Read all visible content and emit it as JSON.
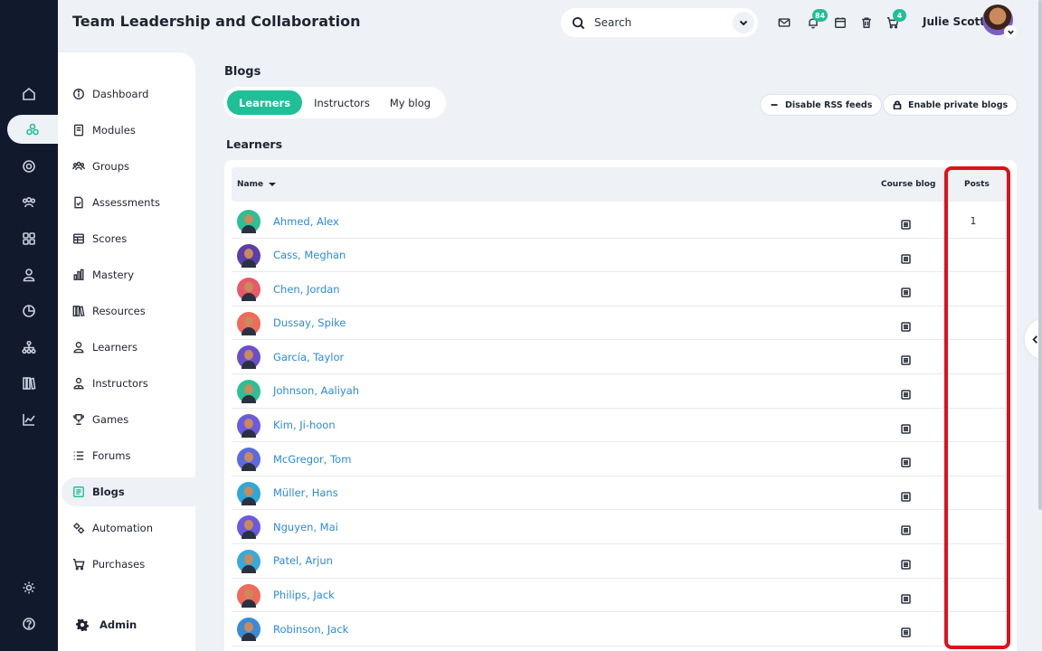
{
  "header": {
    "title": "Team Leadership and Collaboration",
    "search_placeholder": "Search",
    "notifications_count": "84",
    "cart_count": "4",
    "user_name": "Julie Scott"
  },
  "rail": [
    "home-icon",
    "modules-icon",
    "target-icon",
    "users-icon",
    "grid-icon",
    "user-icon",
    "pie-chart-icon",
    "hierarchy-icon",
    "library-icon",
    "trend-icon",
    "settings-icon",
    "help-icon"
  ],
  "menu": {
    "items": [
      {
        "label": "Dashboard",
        "icon": "info-circle-icon"
      },
      {
        "label": "Modules",
        "icon": "book-icon"
      },
      {
        "label": "Groups",
        "icon": "group-icon"
      },
      {
        "label": "Assessments",
        "icon": "file-check-icon"
      },
      {
        "label": "Scores",
        "icon": "table-icon"
      },
      {
        "label": "Mastery",
        "icon": "bar-chart-icon"
      },
      {
        "label": "Resources",
        "icon": "library-icon"
      },
      {
        "label": "Learners",
        "icon": "user-icon"
      },
      {
        "label": "Instructors",
        "icon": "instructor-icon"
      },
      {
        "label": "Games",
        "icon": "trophy-icon"
      },
      {
        "label": "Forums",
        "icon": "list-icon"
      },
      {
        "label": "Blogs",
        "icon": "blog-icon"
      },
      {
        "label": "Automation",
        "icon": "gears-icon"
      },
      {
        "label": "Purchases",
        "icon": "cart-icon"
      }
    ],
    "active": "Blogs",
    "admin_label": "Admin"
  },
  "page": {
    "title": "Blogs",
    "tabs": [
      "Learners",
      "Instructors",
      "My blog"
    ],
    "active_tab": "Learners",
    "disable_rss_label": "Disable RSS feeds",
    "enable_private_label": "Enable private blogs",
    "section_title": "Learners"
  },
  "table": {
    "columns": {
      "name": "Name",
      "course_blog": "Course blog",
      "posts": "Posts"
    },
    "rows": [
      {
        "name": "Ahmed, Alex",
        "posts": "1",
        "color": "#2dbf95"
      },
      {
        "name": "Cass, Meghan",
        "posts": "",
        "color": "#5a3fa8"
      },
      {
        "name": "Chen, Jordan",
        "posts": "",
        "color": "#e85a6a"
      },
      {
        "name": "Dussay, Spike",
        "posts": "",
        "color": "#ef6a5a"
      },
      {
        "name": "García, Taylor",
        "posts": "",
        "color": "#6a4fc8"
      },
      {
        "name": "Johnson, Aaliyah",
        "posts": "",
        "color": "#2dbf95"
      },
      {
        "name": "Kim, Ji-hoon",
        "posts": "",
        "color": "#6a5ae0"
      },
      {
        "name": "McGregor, Tom",
        "posts": "",
        "color": "#5a6ae0"
      },
      {
        "name": "Müller, Hans",
        "posts": "",
        "color": "#2da8d8"
      },
      {
        "name": "Nguyen, Mai",
        "posts": "",
        "color": "#6a5ae0"
      },
      {
        "name": "Patel, Arjun",
        "posts": "",
        "color": "#3aa8d8"
      },
      {
        "name": "Philips, Jack",
        "posts": "",
        "color": "#ef6a5a"
      },
      {
        "name": "Robinson, Jack",
        "posts": "",
        "color": "#3a8ad8"
      }
    ]
  },
  "colors": {
    "accent": "#1fbf98",
    "link": "#2d8ad8",
    "highlight": "#e0101a",
    "rail": "#111a2c"
  }
}
